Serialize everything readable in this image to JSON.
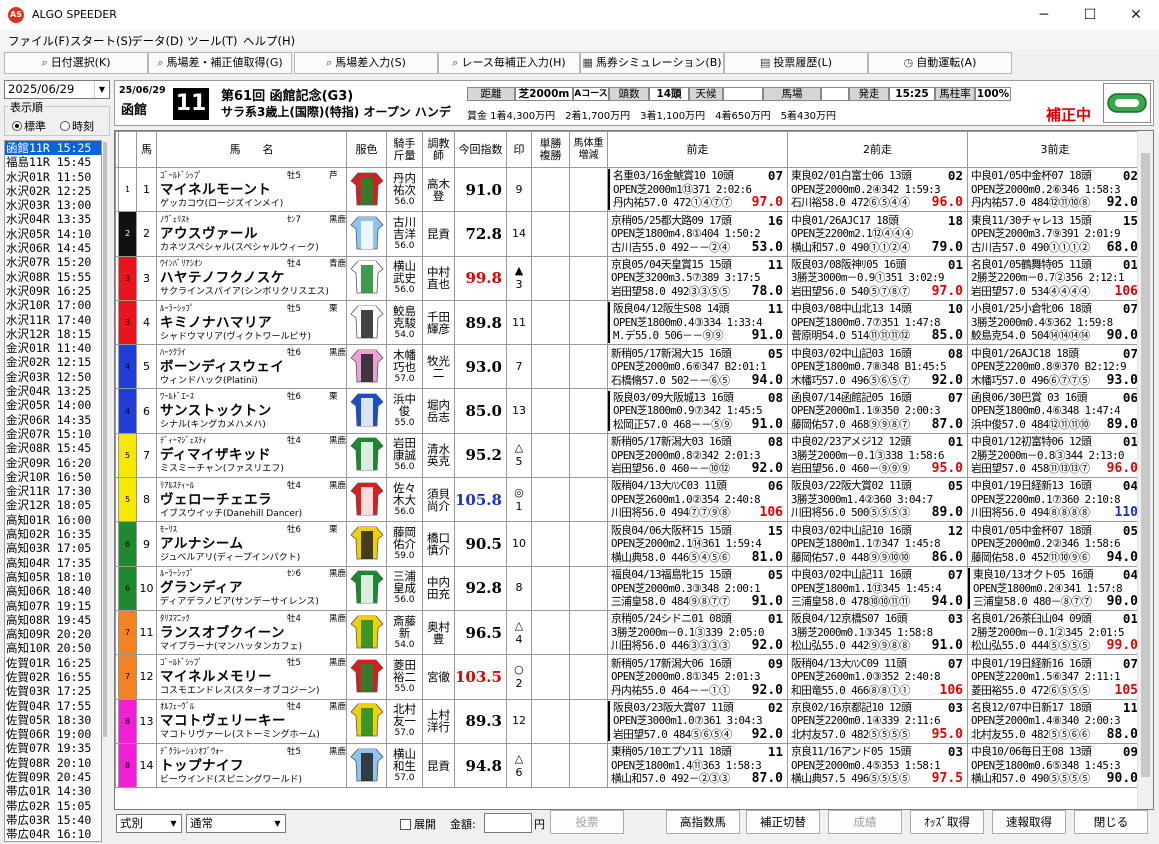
{
  "window": {
    "title": "ALGO SPEEDER",
    "icon_text": "AS",
    "min": "─",
    "max": "☐",
    "close": "✕"
  },
  "menu": [
    "ファイル(F)",
    "スタート(S)",
    "データ(D)",
    "ツール(T)",
    "ヘルプ(H)"
  ],
  "toolbar": [
    "日付選択(K)",
    "馬場差・補正値取得(G)",
    "馬場差入力(S)",
    "レース毎補正入力(H)",
    "馬券シミュレーション(B)",
    "投票履歴(L)",
    "自動運転(A)"
  ],
  "date": "2025/06/29",
  "display_mode": {
    "title": "表示順",
    "options": [
      "標準",
      "時刻"
    ],
    "selected": 0
  },
  "races": [
    "函館11R 15:25",
    "福島11R 15:45",
    "水沢01R 11:50",
    "水沢02R 12:25",
    "水沢03R 13:00",
    "水沢04R 13:35",
    "水沢05R 14:10",
    "水沢06R 14:45",
    "水沢07R 15:20",
    "水沢08R 15:55",
    "水沢09R 16:25",
    "水沢10R 17:00",
    "水沢11R 17:40",
    "水沢12R 18:15",
    "金沢01R 11:40",
    "金沢02R 12:15",
    "金沢03R 12:50",
    "金沢04R 13:25",
    "金沢05R 14:00",
    "金沢06R 14:35",
    "金沢07R 15:10",
    "金沢08R 15:45",
    "金沢09R 16:20",
    "金沢10R 16:50",
    "金沢11R 17:30",
    "金沢12R 18:05",
    "高知01R 16:00",
    "高知02R 16:35",
    "高知03R 17:05",
    "高知04R 17:35",
    "高知05R 18:10",
    "高知06R 18:40",
    "高知07R 19:15",
    "高知08R 19:45",
    "高知09R 20:20",
    "高知10R 20:50",
    "佐賀01R 16:25",
    "佐賀02R 16:55",
    "佐賀03R 17:25",
    "佐賀04R 17:55",
    "佐賀05R 18:30",
    "佐賀06R 19:00",
    "佐賀07R 19:35",
    "佐賀08R 20:10",
    "佐賀09R 20:45",
    "帯広01R 14:30",
    "帯広02R 15:05",
    "帯広03R 15:40",
    "帯広04R 16:10"
  ],
  "race": {
    "date": "25/06/29",
    "course": "函館",
    "number": "11",
    "title": "第61回 函館記念(G3)",
    "cond": "サラ系3歳上(国際)(特指) オープン ハンデ",
    "prize": "賞金 1着4,300万円　2着1,700万円　3着1,100万円　4着650万円　5着430万円",
    "dist_lbl": "距離",
    "dist": "芝2000m",
    "course_type": "Aコース",
    "heads_lbl": "頭数",
    "heads": "14頭",
    "weather_lbl": "天候",
    "weather": "",
    "baba_lbl": "馬場",
    "baba": "",
    "start_lbl": "発走",
    "start": "15:25",
    "rate_lbl": "馬柱率",
    "rate": "100%",
    "correction": "補正中"
  },
  "columns": {
    "umaban": "馬",
    "name": "馬　　名",
    "silk": "服色",
    "jockey": "騎手\n斤量",
    "trainer": "調教\n師",
    "index": "今回指数",
    "mark": "印",
    "odds": "単勝\n複勝",
    "weight": "馬体重\n増減",
    "prev1": "前走",
    "prev2": "2前走",
    "prev3": "3前走"
  },
  "horses": [
    {
      "waku": 1,
      "umaban": "1",
      "sire": "ｺﾞｰﾙﾄﾞｼｯﾌﾟ",
      "sex": "牡5",
      "region": "芦",
      "name": "マイネルモーント",
      "dam": "ゲッカコウ(ロージズインメイ)",
      "jockey": "丹内\n祐次",
      "weight": "56.0",
      "trainer": "高木\n登",
      "index": "91.0",
      "index_color": "#000",
      "mark": "",
      "pop": "9",
      "silk": [
        "#d42020",
        "#1a8a2e"
      ],
      "prev": [
        [
          "名重03/16金鯱賞10 10頭",
          "07",
          "OPEN芝2000m1⑬371 2:02:6",
          "丹内祐57.0 472①④⑦⑦",
          "97.0",
          "#e00000",
          1
        ],
        [
          "東良02/01白富士06 13頭",
          "02",
          "OPEN芝2000m0.2④342 1:59:3",
          "石川裕58.0 472⑥⑤④④",
          "96.0",
          "#e00000",
          0
        ],
        [
          "中良01/05中金杯07 18頭",
          "02",
          "OPEN芝2000m0.2⑥346 1:58:3",
          "丹内祐57.0 484⑫⑪⑩⑧",
          "92.0",
          "#000",
          0
        ]
      ]
    },
    {
      "waku": 2,
      "umaban": "2",
      "sire": "ﾉｳﾞｪﾘｽﾄ",
      "sex": "ｾﾝ7",
      "region": "黒鹿",
      "name": "アウスヴァール",
      "dam": "カネツスペシャル(スペシャルウィーク)",
      "jockey": "古川\n吉洋",
      "weight": "56.0",
      "trainer": "昆貢",
      "index": "72.8",
      "index_color": "#000",
      "mark": "",
      "pop": "14",
      "silk": [
        "#8cc6f0",
        "#ffffff"
      ],
      "prev": [
        [
          "京稍05/25都大路09 17頭",
          "16",
          "OPEN芝1800m4.8①404 1:50:2",
          "古川吉55.0 492－－②④",
          "53.0",
          "#000",
          0
        ],
        [
          "中良01/26AJC17 18頭",
          "18",
          "OPEN芝2200m2.1⑫④④④",
          "横山和57.0 490①①②④",
          "79.0",
          "#000",
          0
        ],
        [
          "東良11/30チャレ13 15頭",
          "15",
          "OPEN芝2000m3.7⑨391 2:01:9",
          "古川吉57.0 490①①①②",
          "68.0",
          "#000",
          0
        ]
      ]
    },
    {
      "waku": 3,
      "umaban": "3",
      "sire": "ｳｲﾝﾊﾞﾘｱｼｵﾝ",
      "sex": "牡4",
      "region": "青鹿",
      "name": "ハヤテノフクノスケ",
      "dam": "サクラインスパイア(シンボリクリスエス)",
      "jockey": "横山\n武史",
      "weight": "56.0",
      "trainer": "中村\n直也",
      "index": "99.8",
      "index_color": "#e00000",
      "mark": "▲",
      "pop": "3",
      "silk": [
        "#ffffff",
        "#1a8a2e"
      ],
      "prev": [
        [
          "京良05/04天皇賞15 15頭",
          "11",
          "OPEN芝3200m3.5⑦389 3:17:5",
          "岩田望58.0 492③③⑤⑤",
          "78.0",
          "#000",
          0
        ],
        [
          "阪良03/08阪神ﾘ05 16頭",
          "01",
          "3勝芝3000m－0.9①351 3:02:9",
          "岩田望56.0 540⑤⑦⑧⑦",
          "97.0",
          "#e00000",
          0
        ],
        [
          "名良01/05鶴舞特05 11頭",
          "01",
          "2勝芝2200m－0.7②356 2:12:1",
          "岩田望57.0 534④④④④",
          "106",
          "#e00000",
          0
        ]
      ]
    },
    {
      "waku": 3,
      "umaban": "4",
      "sire": "ﾙｰﾗｰｼｯﾌﾟ",
      "sex": "牡5",
      "region": "栗",
      "name": "キミノナハマリア",
      "dam": "シャドウマリア(ヴィクトワールピサ)",
      "jockey": "鮫島\n克駿",
      "weight": "54.0",
      "trainer": "千田\n輝彦",
      "index": "89.8",
      "index_color": "#000",
      "mark": "",
      "pop": "11",
      "silk": [
        "#ffffff",
        "#222222"
      ],
      "prev": [
        [
          "阪良04/12阪生S08 14頭",
          "11",
          "OPEN芝1800m0.4③334 1:33:4",
          "M.デ55.0 506－－⑨⑨",
          "91.0",
          "#000",
          1
        ],
        [
          "中良03/08中山北13 14頭",
          "10",
          "OPEN芝1800m0.7⑦351 1:47:8",
          "菅原明54.0 514⑪⑪⑪⑫",
          "85.0",
          "#000",
          0
        ],
        [
          "小良01/25小倉牝06 18頭",
          "07",
          "3勝芝2000m0.4⑤362 1:59:8",
          "鮫島克54.0 504⑭⑭⑭⑭",
          "90.0",
          "#000",
          0
        ]
      ]
    },
    {
      "waku": 4,
      "umaban": "5",
      "sire": "ﾊｰﾂｸﾗｲ",
      "sex": "牡6",
      "region": "黒鹿",
      "name": "ボーンディスウェイ",
      "dam": "ウィンドハック(Platini)",
      "jockey": "木幡\n巧也",
      "weight": "57.0",
      "trainer": "牧光\n二",
      "index": "93.0",
      "index_color": "#000",
      "mark": "",
      "pop": "7",
      "silk": [
        "#f0a0d8",
        "#222222"
      ],
      "prev": [
        [
          "新稍05/17新潟大15 16頭",
          "05",
          "OPEN芝2000m0.6⑥347 B2:01:1",
          "石橋脩57.0 502－－⑥⑤",
          "94.0",
          "#000",
          0
        ],
        [
          "中良03/02中山記03 16頭",
          "08",
          "OPEN芝1800m0.7⑧348 B1:45:5",
          "木幡巧57.0 496⑤⑥⑤⑦",
          "92.0",
          "#000",
          0
        ],
        [
          "中良01/26AJC18 18頭",
          "07",
          "OPEN芝2200m0.8⑨370 B2:12:9",
          "木幡巧57.0 496⑥⑦⑦⑤",
          "93.0",
          "#000",
          0
        ]
      ]
    },
    {
      "waku": 4,
      "umaban": "6",
      "sire": "ﾜｰﾙﾄﾞｴｰｽ",
      "sex": "牡6",
      "region": "栗",
      "name": "サンストックトン",
      "dam": "シナル(キングカメハメハ)",
      "jockey": "浜中\n俊",
      "weight": "55.0",
      "trainer": "堀内\n岳志",
      "index": "85.0",
      "index_color": "#000",
      "mark": "",
      "pop": "13",
      "silk": [
        "#1a4fc8",
        "#ffffff"
      ],
      "prev": [
        [
          "阪良03/09大阪城13 16頭",
          "08",
          "OPEN芝1800m0.9⑦342 1:45:5",
          "松岡正57.0 468－－⑤⑨",
          "91.0",
          "#000",
          1
        ],
        [
          "函良07/14函館記05 16頭",
          "07",
          "OPEN芝2000m1.1⑨350 2:00:3",
          "藤岡佑57.0 468⑨⑨⑧⑦",
          "87.0",
          "#000",
          0
        ],
        [
          "函良06/30巴賞 03 16頭",
          "06",
          "OPEN芝1800m0.4⑥348 1:47:4",
          "浜中俊57.0 484⑫⑪⑪⑩",
          "89.0",
          "#000",
          0
        ]
      ]
    },
    {
      "waku": 5,
      "umaban": "7",
      "sire": "ﾃﾞｨｰﾏｼﾞｪｽﾃｨ",
      "sex": "牡4",
      "region": "黒鹿",
      "name": "ディマイザキッド",
      "dam": "ミスミーチャン(ファスリエフ)",
      "jockey": "岩田\n康誠",
      "weight": "56.0",
      "trainer": "清水\n英克",
      "index": "95.2",
      "index_color": "#000",
      "mark": "△",
      "pop": "5",
      "silk": [
        "#1a8a2e",
        "#ffffff"
      ],
      "prev": [
        [
          "新稍05/17新潟大03 16頭",
          "08",
          "OPEN芝2000m0.8②342 2:01:3",
          "岩田望56.0 460－－⑩⑫",
          "92.0",
          "#000",
          0
        ],
        [
          "中良02/23アメジ12 12頭",
          "01",
          "3勝芝2000m－0.1③338 1:58:6",
          "岩田望56.0 460－⑨⑨⑨",
          "95.0",
          "#e00000",
          0
        ],
        [
          "中良01/12初富特06 12頭",
          "01",
          "2勝芝2000m－0.8③344 2:13:0",
          "岩田望57.0 458⑪⑬⑬⑦",
          "96.0",
          "#e00000",
          0
        ]
      ]
    },
    {
      "waku": 5,
      "umaban": "8",
      "sire": "ﾘｱﾙｽﾃｨｰﾙ",
      "sex": "牡4",
      "region": "黒鹿",
      "name": "ヴェローチェエラ",
      "dam": "イブスウイッチ(Danehill Dancer)",
      "jockey": "佐々\n木大",
      "weight": "56.0",
      "trainer": "須貝\n尚介",
      "index": "105.8",
      "index_color": "#1a2fd0",
      "mark": "◎",
      "pop": "1",
      "silk": [
        "#d42020",
        "#ffffff"
      ],
      "prev": [
        [
          "阪稍04/13大ﾊﾝC03 11頭",
          "06",
          "OPEN芝2600m1.0②354 2:40:8",
          "川田将56.0 494⑦⑦⑨⑧",
          "106",
          "#e00000",
          0
        ],
        [
          "阪良03/22阪大賞02 11頭",
          "05",
          "3勝芝3000m1.4②360 3:04:7",
          "川田将56.0 500⑤⑤⑤③",
          "89.0",
          "#000",
          0
        ],
        [
          "中良01/19日経新13 16頭",
          "04",
          "OPEN芝2200m0.1⑦360 2:10:8",
          "川田将56.0 494⑧⑧⑧⑧",
          "110",
          "#1a2fd0",
          0
        ]
      ]
    },
    {
      "waku": 6,
      "umaban": "9",
      "sire": "ﾓｰﾘｽ",
      "sex": "牡6",
      "region": "栗",
      "name": "アルナシーム",
      "dam": "ジュベルアリ(ディープインパクト)",
      "jockey": "藤岡\n佑介",
      "weight": "59.0",
      "trainer": "橋口\n慎介",
      "index": "90.5",
      "index_color": "#000",
      "mark": "",
      "pop": "10",
      "silk": [
        "#f0d000",
        "#222222"
      ],
      "prev": [
        [
          "阪良04/06大阪杯15 15頭",
          "15",
          "OPEN芝2000m2.1⑭361 1:59:4",
          "横山典58.0 446⑤④⑤⑥",
          "81.0",
          "#000",
          0
        ],
        [
          "中良03/02中山記10 16頭",
          "12",
          "OPEN芝1800m1.1⑦347 1:45:8",
          "藤岡佑57.0 448⑨⑨⑩⑩",
          "86.0",
          "#000",
          0
        ],
        [
          "中良01/05中金杯07 18頭",
          "05",
          "OPEN芝2000m0.2②346 1:58:6",
          "藤岡佑58.0 452⑪⑩⑨⑥",
          "94.0",
          "#000",
          0
        ]
      ]
    },
    {
      "waku": 6,
      "umaban": "10",
      "sire": "ﾙｰﾗｰｼｯﾌﾟ",
      "sex": "ｾﾝ6",
      "region": "黒鹿",
      "name": "グランディア",
      "dam": "ディアデラノビア(サンデーサイレンス)",
      "jockey": "三浦\n皇成",
      "weight": "56.0",
      "trainer": "中内\n田充",
      "index": "92.8",
      "index_color": "#000",
      "mark": "",
      "pop": "8",
      "silk": [
        "#1a8a2e",
        "#ffffff"
      ],
      "prev": [
        [
          "福良04/13福島牝15 15頭",
          "05",
          "OPEN芝2000m0.3③348 2:00:1",
          "三浦皇58.0 484⑨⑧⑦⑦",
          "91.0",
          "#000",
          0
        ],
        [
          "中良03/02中山記11 16頭",
          "07",
          "OPEN芝1800m1.1⑬345 1:45:4",
          "三浦皇58.0 478⑩⑩⑪⑪",
          "94.0",
          "#000",
          0
        ],
        [
          "東良10/13オクト05 16頭",
          "04",
          "OPEN芝1800m0.2④341 1:57:8",
          "三浦皇58.0 480－⑧⑦⑦",
          "90.0",
          "#000",
          1
        ]
      ]
    },
    {
      "waku": 7,
      "umaban": "11",
      "sire": "ﾀﾘｽﾏﾆｯｸ",
      "sex": "牡4",
      "region": "黒鹿",
      "name": "ランスオブクイーン",
      "dam": "マイプラーナ(マンハッタンカフェ)",
      "jockey": "斎藤\n新",
      "weight": "54.0",
      "trainer": "奥村\n豊",
      "index": "96.5",
      "index_color": "#000",
      "mark": "△",
      "pop": "4",
      "silk": [
        "#f0d000",
        "#1a8a2e"
      ],
      "prev": [
        [
          "京稍05/24シドニ01 08頭",
          "01",
          "3勝芝2000m－0.1③339 2:05:0",
          "川田将56.0 446③③③③",
          "92.0",
          "#000",
          0
        ],
        [
          "阪良04/12京橋S07 16頭",
          "03",
          "3勝芝2000m0.1③345 1:58:8",
          "松山弘55.0 442⑨⑨⑧⑧",
          "91.0",
          "#000",
          0
        ],
        [
          "名良01/26茶臼山04 09頭",
          "01",
          "2勝芝2000m－0.1②345 2:01:5",
          "松山弘55.0 444⑤⑤⑤⑤",
          "99.0",
          "#e00000",
          0
        ]
      ]
    },
    {
      "waku": 7,
      "umaban": "12",
      "sire": "ｺﾞｰﾙﾄﾞｼｯﾌﾟ",
      "sex": "牡5",
      "region": "黒鹿",
      "name": "マイネルメモリー",
      "dam": "コスモエンドレス(スターオブコジーン)",
      "jockey": "菱田\n裕二",
      "weight": "55.0",
      "trainer": "宮徹",
      "index": "103.5",
      "index_color": "#e00000",
      "mark": "○",
      "pop": "2",
      "silk": [
        "#d42020",
        "#1a8a2e"
      ],
      "prev": [
        [
          "新稍05/17新潟大06 16頭",
          "09",
          "OPEN芝2000m0.8①345 2:01:3",
          "丹内祐55.0 464－－①①",
          "92.0",
          "#000",
          0
        ],
        [
          "阪稍04/13大ﾊﾝC09 11頭",
          "07",
          "OPEN芝2600m1.0③352 2:40:8",
          "和田竜55.0 466⑧⑧①①",
          "106",
          "#e00000",
          0
        ],
        [
          "中良01/19日経新16 16頭",
          "07",
          "OPEN芝2200m1.5⑥347 2:11:1",
          "菱田裕55.0 472⑥⑤⑤⑤",
          "105",
          "#e00000",
          0
        ]
      ]
    },
    {
      "waku": 8,
      "umaban": "13",
      "sire": "ｵﾙﾌｪｰｳﾞﾙ",
      "sex": "牡4",
      "region": "黒鹿",
      "name": "マコトヴェリーキー",
      "dam": "マコトリヴァーレ(ストーミングホーム)",
      "jockey": "北村\n友一",
      "weight": "57.0",
      "trainer": "上村\n洋行",
      "index": "89.3",
      "index_color": "#000",
      "mark": "",
      "pop": "12",
      "silk": [
        "#f0d000",
        "#1a8a2e"
      ],
      "prev": [
        [
          "阪良03/23阪大賞07 11頭",
          "02",
          "OPEN芝3000m1.0⑦361 3:04:3",
          "岩田望57.0 484⑤⑥⑤④",
          "92.0",
          "#000",
          1
        ],
        [
          "京良02/16京都記10 12頭",
          "03",
          "OPEN芝2200m0.1④339 2:11:6",
          "北村友57.0 482⑤⑤⑤⑤",
          "95.0",
          "#e00000",
          0
        ],
        [
          "名良12/07中日新17 18頭",
          "11",
          "OPEN芝2000m1.4⑧340 2:00:3",
          "北村友55.0 482⑤⑤⑥⑥",
          "88.0",
          "#000",
          0
        ]
      ]
    },
    {
      "waku": 8,
      "umaban": "14",
      "sire": "ﾃﾞｸﾗﾚｰｼｮﾝｵﾌﾞｳｫｰ",
      "sex": "牡5",
      "region": "黒鹿",
      "name": "トップナイフ",
      "dam": "ビーウインド(スピニングワールド)",
      "jockey": "横山\n和生",
      "weight": "57.0",
      "trainer": "昆貢",
      "index": "94.8",
      "index_color": "#000",
      "mark": "△",
      "pop": "6",
      "silk": [
        "#8cc6f0",
        "#222222"
      ],
      "prev": [
        [
          "東稍05/10エプソ11 18頭",
          "11",
          "OPEN芝1800m1.4⑪363 1:58:3",
          "横山和57.0 492－②③③",
          "87.0",
          "#000",
          0
        ],
        [
          "京良11/16アンド05 15頭",
          "03",
          "OPEN芝2000m0.4⑤353 1:58:1",
          "横山典57.5 496⑤⑤⑤⑤",
          "97.5",
          "#e00000",
          0
        ],
        [
          "中良10/06毎日王08 13頭",
          "09",
          "OPEN芝1800m0.6⑤348 1:45:3",
          "横山和57.0 490⑤⑤⑤⑤",
          "90.0",
          "#000",
          0
        ]
      ]
    }
  ],
  "waku_colors": [
    "#ffffff",
    "#111111",
    "#e8141e",
    "#1f3fd6",
    "#f6e800",
    "#1e8a2e",
    "#f58220",
    "#f31fd7"
  ],
  "bottom": {
    "sort": "式別",
    "type": "通常",
    "expand": "展開",
    "amount_lbl": "金額:",
    "yen": "円",
    "vote": "投票",
    "high_idx": "高指数馬",
    "toggle": "補正切替",
    "result": "成績",
    "odds": "ｵｯｽﾞ取得",
    "fast": "速報取得",
    "close": "閉じる"
  }
}
